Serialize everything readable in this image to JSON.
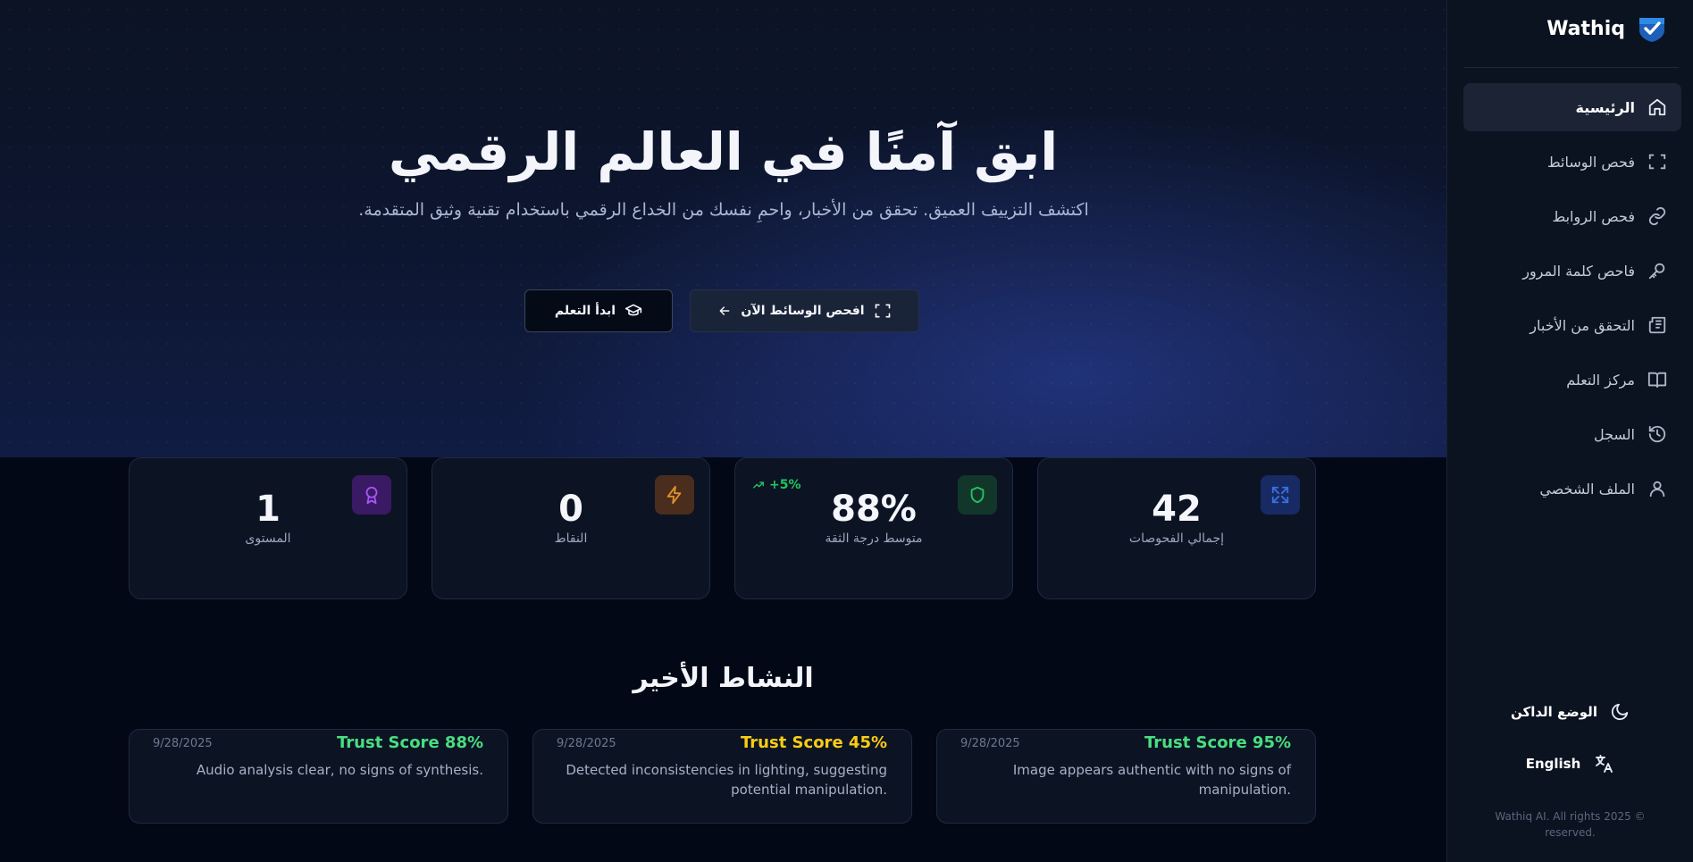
{
  "app": {
    "name": "Wathiq",
    "accent": "#3b82f6"
  },
  "hero": {
    "title": "ابق آمنًا في العالم الرقمي",
    "subtitle": "اكتشف التزييف العميق. تحقق من الأخبار، واحمِ نفسك من الخداع الرقمي باستخدام تقنية وثيق المتقدمة.",
    "primary_button": "افحص الوسائط الآن",
    "secondary_button": "ابدأ التعلم"
  },
  "stats": [
    {
      "value": "42",
      "label": "إجمالي الفحوصات",
      "icon": "scan-expand-icon",
      "color": "#3b6fe0"
    },
    {
      "value": "88%",
      "label": "متوسط درجة الثقة",
      "icon": "shield-icon",
      "color": "#22c55e",
      "trend": "+5%"
    },
    {
      "value": "0",
      "label": "النقاط",
      "icon": "lightning-icon",
      "color": "#e0932b"
    },
    {
      "value": "1",
      "label": "المستوى",
      "icon": "award-icon",
      "color": "#a855f7"
    }
  ],
  "activity": {
    "title": "النشاط الأخير",
    "items": [
      {
        "score": "Trust Score 95%",
        "score_color": "#4ade80",
        "date": "9/28/2025",
        "text": "Image appears authentic with no signs of manipulation."
      },
      {
        "score": "Trust Score 45%",
        "score_color": "#facc15",
        "date": "9/28/2025",
        "text": "Detected inconsistencies in lighting, suggesting potential manipulation."
      },
      {
        "score": "Trust Score 88%",
        "score_color": "#4ade80",
        "date": "9/28/2025",
        "text": "Audio analysis clear, no signs of synthesis."
      }
    ]
  },
  "sidebar": {
    "items": [
      {
        "label": "الرئيسية",
        "icon": "home-icon",
        "active": true
      },
      {
        "label": "فحص الوسائط",
        "icon": "scan-icon"
      },
      {
        "label": "فحص الروابط",
        "icon": "link-icon"
      },
      {
        "label": "فاحص كلمة المرور",
        "icon": "key-icon"
      },
      {
        "label": "التحقق من الأخبار",
        "icon": "newspaper-icon"
      },
      {
        "label": "مركز التعلم",
        "icon": "book-icon"
      },
      {
        "label": "السجل",
        "icon": "history-icon"
      },
      {
        "label": "الملف الشخصي",
        "icon": "user-icon"
      }
    ],
    "dark_mode": "الوضع الداكن",
    "language": "English",
    "copyright": "Wathiq AI. All rights 2025 © reserved."
  }
}
